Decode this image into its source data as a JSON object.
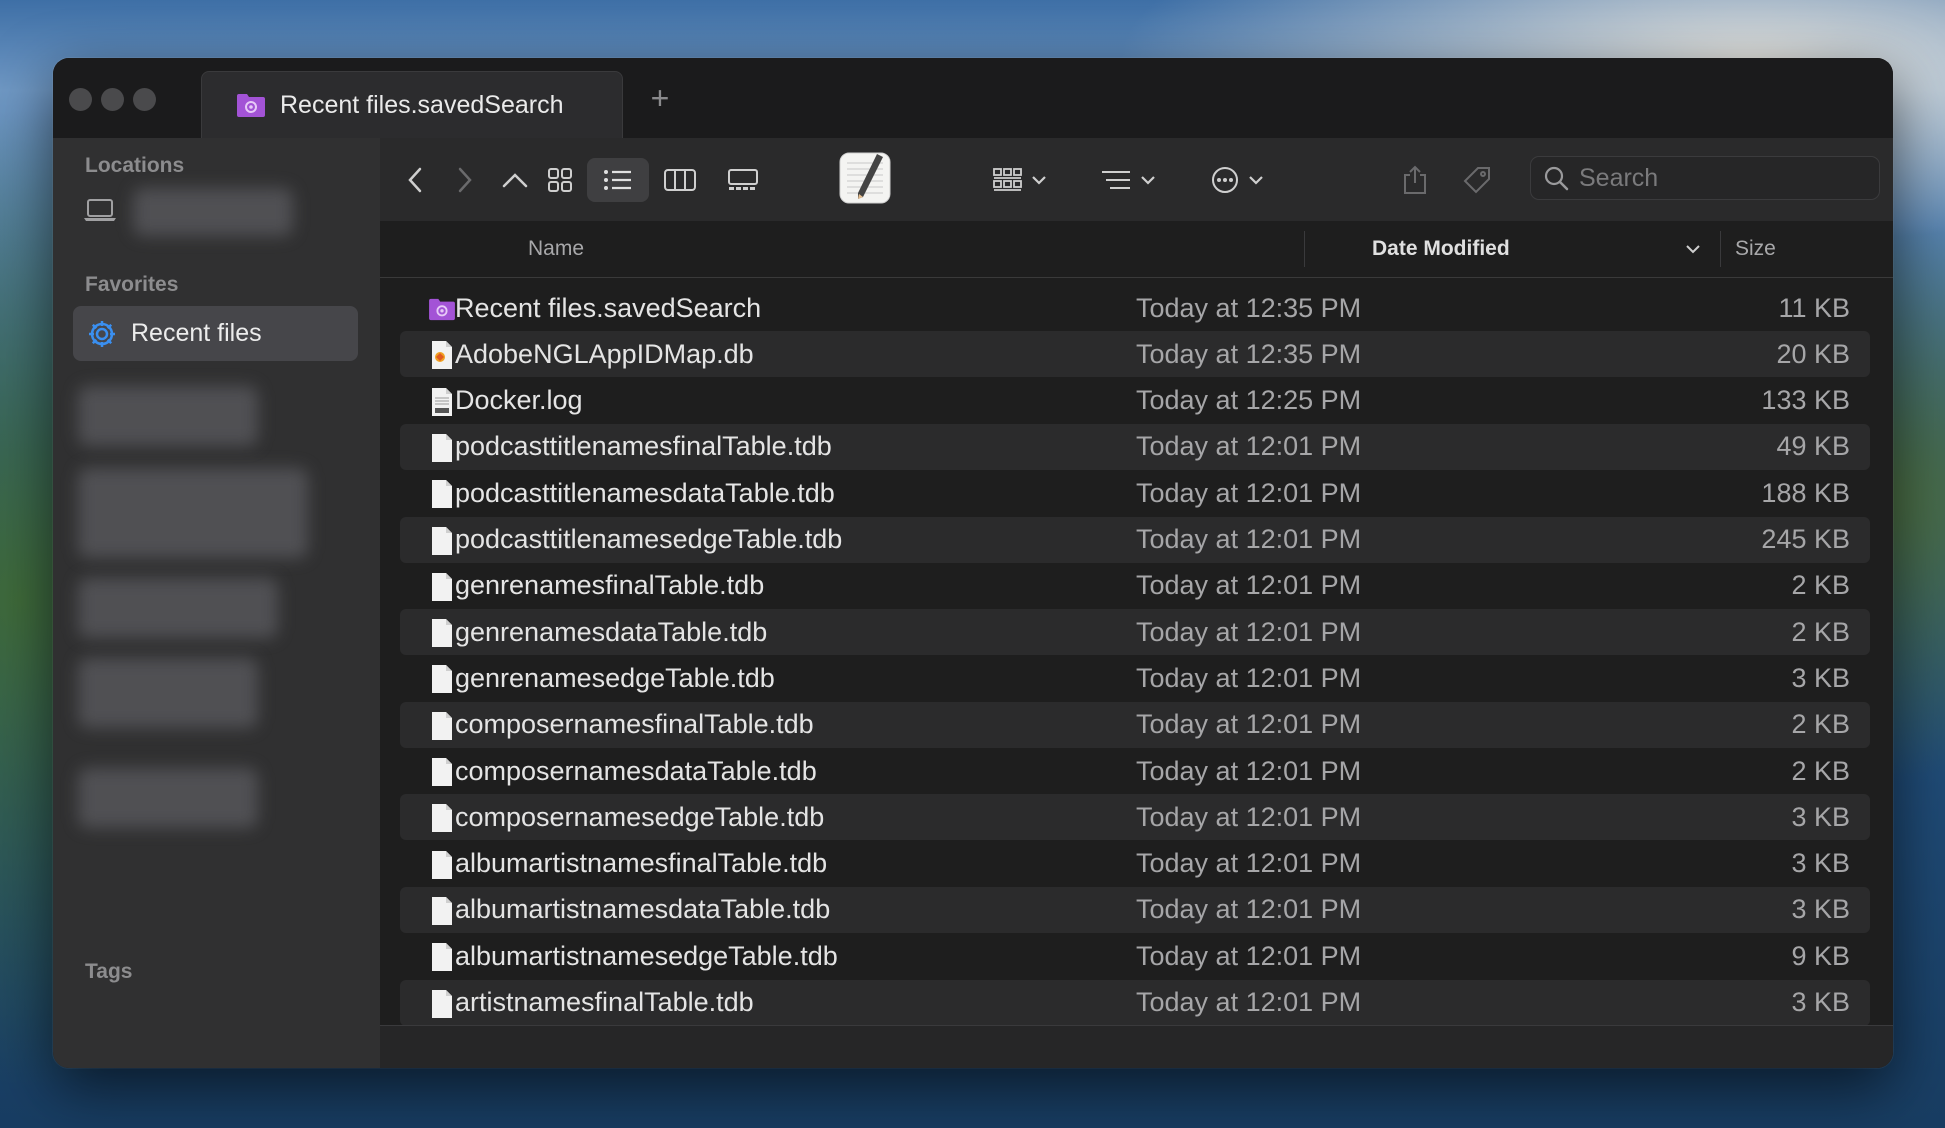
{
  "window": {
    "tab_title": "Recent files.savedSearch",
    "add_tab_symbol": "+"
  },
  "sidebar": {
    "locations_heading": "Locations",
    "favorites_heading": "Favorites",
    "selected_item": "Recent files",
    "tags_heading": "Tags"
  },
  "toolbar": {
    "search_placeholder": "Search"
  },
  "columns": {
    "name": "Name",
    "date_modified": "Date Modified",
    "size": "Size"
  },
  "files": [
    {
      "name": "Recent files.savedSearch",
      "date": "Today at 12:35 PM",
      "size": "11 KB",
      "icon": "smart-folder-icon"
    },
    {
      "name": "AdobeNGLAppIDMap.db",
      "date": "Today at 12:35 PM",
      "size": "20 KB",
      "icon": "database-file-icon"
    },
    {
      "name": "Docker.log",
      "date": "Today at 12:25 PM",
      "size": "133 KB",
      "icon": "log-file-icon"
    },
    {
      "name": "podcasttitlenamesfinalTable.tdb",
      "date": "Today at 12:01 PM",
      "size": "49 KB",
      "icon": "document-icon"
    },
    {
      "name": "podcasttitlenamesdataTable.tdb",
      "date": "Today at 12:01 PM",
      "size": "188 KB",
      "icon": "document-icon"
    },
    {
      "name": "podcasttitlenamesedgeTable.tdb",
      "date": "Today at 12:01 PM",
      "size": "245 KB",
      "icon": "document-icon"
    },
    {
      "name": "genrenamesfinalTable.tdb",
      "date": "Today at 12:01 PM",
      "size": "2 KB",
      "icon": "document-icon"
    },
    {
      "name": "genrenamesdataTable.tdb",
      "date": "Today at 12:01 PM",
      "size": "2 KB",
      "icon": "document-icon"
    },
    {
      "name": "genrenamesedgeTable.tdb",
      "date": "Today at 12:01 PM",
      "size": "3 KB",
      "icon": "document-icon"
    },
    {
      "name": "composernamesfinalTable.tdb",
      "date": "Today at 12:01 PM",
      "size": "2 KB",
      "icon": "document-icon"
    },
    {
      "name": "composernamesdataTable.tdb",
      "date": "Today at 12:01 PM",
      "size": "2 KB",
      "icon": "document-icon"
    },
    {
      "name": "composernamesedgeTable.tdb",
      "date": "Today at 12:01 PM",
      "size": "3 KB",
      "icon": "document-icon"
    },
    {
      "name": "albumartistnamesfinalTable.tdb",
      "date": "Today at 12:01 PM",
      "size": "3 KB",
      "icon": "document-icon"
    },
    {
      "name": "albumartistnamesdataTable.tdb",
      "date": "Today at 12:01 PM",
      "size": "3 KB",
      "icon": "document-icon"
    },
    {
      "name": "albumartistnamesedgeTable.tdb",
      "date": "Today at 12:01 PM",
      "size": "9 KB",
      "icon": "document-icon"
    },
    {
      "name": "artistnamesfinalTable.tdb",
      "date": "Today at 12:01 PM",
      "size": "3 KB",
      "icon": "document-icon"
    }
  ],
  "colors": {
    "smart_folder_purple": "#a353d6",
    "selection_gray": "#46464a",
    "accent_blue": "#3a8ff0"
  }
}
